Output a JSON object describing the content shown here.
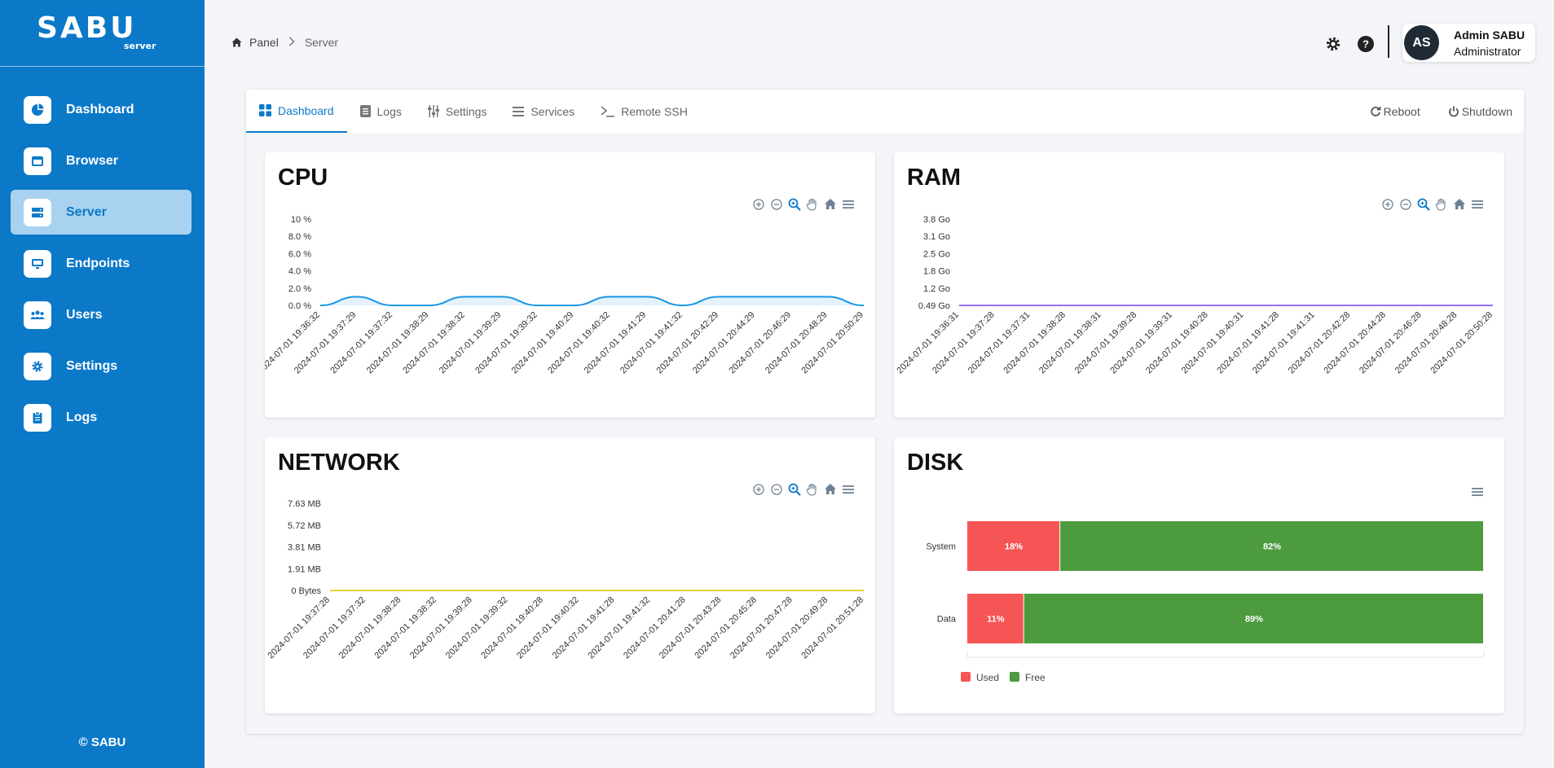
{
  "app": {
    "logo_main": "SABU",
    "logo_sub": "server",
    "copyright": "© SABU"
  },
  "sidebar": {
    "items": [
      {
        "label": "Dashboard",
        "icon": "pie-chart-icon"
      },
      {
        "label": "Browser",
        "icon": "window-icon"
      },
      {
        "label": "Server",
        "icon": "server-icon",
        "active": true
      },
      {
        "label": "Endpoints",
        "icon": "monitor-icon"
      },
      {
        "label": "Users",
        "icon": "users-icon"
      },
      {
        "label": "Settings",
        "icon": "gear-icon"
      },
      {
        "label": "Logs",
        "icon": "clipboard-icon"
      }
    ]
  },
  "breadcrumb": {
    "home": "Panel",
    "current": "Server"
  },
  "user": {
    "initials": "AS",
    "name": "Admin SABU",
    "role": "Administrator"
  },
  "tabs": [
    {
      "label": "Dashboard",
      "icon": "grid-icon"
    },
    {
      "label": "Logs",
      "icon": "document-icon"
    },
    {
      "label": "Settings",
      "icon": "sliders-icon"
    },
    {
      "label": "Services",
      "icon": "list-icon"
    },
    {
      "label": "Remote SSH",
      "icon": "terminal-icon"
    }
  ],
  "actions": {
    "reboot": "Reboot",
    "shutdown": "Shutdown"
  },
  "colors": {
    "brand": "#0b79c8",
    "cpu": "#1b96e6",
    "ram": "#9b6cf0",
    "network": "#e8d43a",
    "used": "#f65556",
    "free": "#4c9b3f"
  },
  "chart_data": [
    {
      "type": "area",
      "title": "CPU",
      "y_ticks": [
        "10 %",
        "8.0 %",
        "6.0 %",
        "4.0 %",
        "2.0 %",
        "0.0 %"
      ],
      "ylim": [
        0,
        10
      ],
      "x": [
        "2024-07-01 19:36:32",
        "2024-07-01 19:37:29",
        "2024-07-01 19:37:32",
        "2024-07-01 19:38:29",
        "2024-07-01 19:38:32",
        "2024-07-01 19:39:29",
        "2024-07-01 19:39:32",
        "2024-07-01 19:40:29",
        "2024-07-01 19:40:32",
        "2024-07-01 19:41:29",
        "2024-07-01 19:41:32",
        "2024-07-01 20:42:29",
        "2024-07-01 20:44:29",
        "2024-07-01 20:46:29",
        "2024-07-01 20:48:29",
        "2024-07-01 20:50:29"
      ],
      "values": [
        0,
        1,
        0,
        0,
        1,
        1,
        0,
        0,
        1,
        1,
        0,
        1,
        1,
        1,
        1,
        0
      ]
    },
    {
      "type": "area",
      "title": "RAM",
      "y_ticks": [
        "3.8 Go",
        "3.1 Go",
        "2.5 Go",
        "1.8 Go",
        "1.2 Go",
        "0.49 Go"
      ],
      "ylim": [
        0.49,
        3.8
      ],
      "x": [
        "2024-07-01 19:36:31",
        "2024-07-01 19:37:28",
        "2024-07-01 19:37:31",
        "2024-07-01 19:38:28",
        "2024-07-01 19:38:31",
        "2024-07-01 19:39:28",
        "2024-07-01 19:39:31",
        "2024-07-01 19:40:28",
        "2024-07-01 19:40:31",
        "2024-07-01 19:41:28",
        "2024-07-01 19:41:31",
        "2024-07-01 20:42:28",
        "2024-07-01 20:44:28",
        "2024-07-01 20:46:28",
        "2024-07-01 20:48:28",
        "2024-07-01 20:50:28"
      ],
      "values": [
        0.49,
        0.49,
        0.49,
        0.49,
        0.49,
        0.49,
        0.49,
        0.49,
        0.49,
        0.49,
        0.49,
        0.49,
        0.49,
        0.49,
        0.49,
        0.49
      ]
    },
    {
      "type": "area",
      "title": "NETWORK",
      "y_ticks": [
        "7.63 MB",
        "5.72 MB",
        "3.81 MB",
        "1.91 MB",
        "0 Bytes"
      ],
      "ylim": [
        0,
        7.63
      ],
      "x": [
        "2024-07-01 19:37:28",
        "2024-07-01 19:37:32",
        "2024-07-01 19:38:28",
        "2024-07-01 19:38:32",
        "2024-07-01 19:39:28",
        "2024-07-01 19:39:32",
        "2024-07-01 19:40:28",
        "2024-07-01 19:40:32",
        "2024-07-01 19:41:28",
        "2024-07-01 19:41:32",
        "2024-07-01 20:41:28",
        "2024-07-01 20:43:28",
        "2024-07-01 20:45:28",
        "2024-07-01 20:47:28",
        "2024-07-01 20:49:28",
        "2024-07-01 20:51:28"
      ],
      "values": [
        0,
        0,
        0,
        0,
        0,
        0,
        0,
        0,
        0,
        0,
        0,
        0,
        0,
        0,
        0,
        0
      ]
    },
    {
      "type": "bar",
      "title": "DISK",
      "stacked": true,
      "horizontal": true,
      "categories": [
        "System",
        "Data"
      ],
      "series": [
        {
          "name": "Used",
          "values": [
            18,
            11
          ],
          "labels": [
            "18%",
            "11%"
          ]
        },
        {
          "name": "Free",
          "values": [
            82,
            89
          ],
          "labels": [
            "82%",
            "89%"
          ]
        }
      ],
      "legend": "bottom-left"
    }
  ]
}
